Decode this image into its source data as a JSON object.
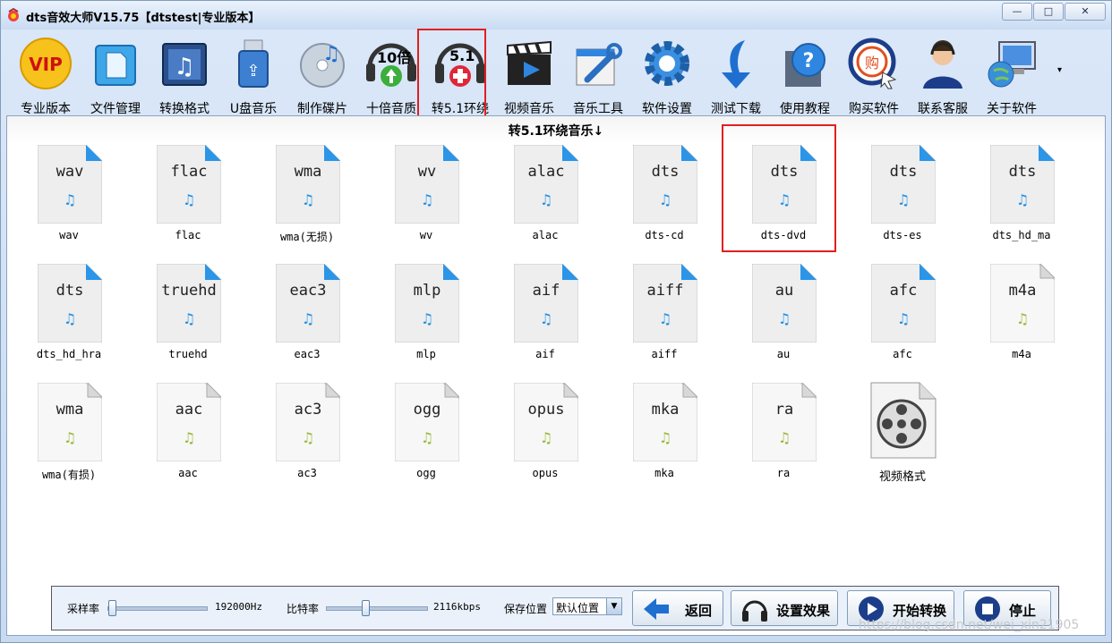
{
  "app": {
    "title": "dts音效大师V15.75【dtstest|专业版本】",
    "window_buttons": {
      "minimize": "—",
      "maximize": "□",
      "close": "✕"
    }
  },
  "toolbar": {
    "items": [
      {
        "label": "专业版本",
        "icon": "vip-badge-icon"
      },
      {
        "label": "文件管理",
        "icon": "folder-icon"
      },
      {
        "label": "转换格式",
        "icon": "music-convert-icon"
      },
      {
        "label": "U盘音乐",
        "icon": "usb-drive-icon"
      },
      {
        "label": "制作碟片",
        "icon": "disc-icon"
      },
      {
        "label": "十倍音质",
        "icon": "10x-quality-icon"
      },
      {
        "label": "转5.1环绕",
        "icon": "surround-5-1-icon"
      },
      {
        "label": "视频音乐",
        "icon": "clapperboard-icon"
      },
      {
        "label": "音乐工具",
        "icon": "tools-icon"
      },
      {
        "label": "软件设置",
        "icon": "gear-icon"
      },
      {
        "label": "测试下载",
        "icon": "download-arrow-icon"
      },
      {
        "label": "使用教程",
        "icon": "help-icon"
      },
      {
        "label": "购买软件",
        "icon": "buy-icon"
      },
      {
        "label": "联系客服",
        "icon": "support-agent-icon"
      },
      {
        "label": "关于软件",
        "icon": "computer-globe-icon"
      }
    ],
    "badge_10x": "10倍",
    "badge_51": "5.1",
    "more_arrow": "▾"
  },
  "panel": {
    "title": "转5.1环绕音乐↓"
  },
  "files": [
    {
      "ext": "wav",
      "label": "wav",
      "style": "blue"
    },
    {
      "ext": "flac",
      "label": "flac",
      "style": "blue"
    },
    {
      "ext": "wma",
      "label": "wma(无损)",
      "style": "blue"
    },
    {
      "ext": "wv",
      "label": "wv",
      "style": "blue"
    },
    {
      "ext": "alac",
      "label": "alac",
      "style": "blue"
    },
    {
      "ext": "dts",
      "label": "dts-cd",
      "style": "blue"
    },
    {
      "ext": "dts",
      "label": "dts-dvd",
      "style": "blue"
    },
    {
      "ext": "dts",
      "label": "dts-es",
      "style": "blue"
    },
    {
      "ext": "dts",
      "label": "dts_hd_ma",
      "style": "blue"
    },
    {
      "ext": "dts",
      "label": "dts_hd_hra",
      "style": "blue"
    },
    {
      "ext": "truehd",
      "label": "truehd",
      "style": "blue"
    },
    {
      "ext": "eac3",
      "label": "eac3",
      "style": "blue"
    },
    {
      "ext": "mlp",
      "label": "mlp",
      "style": "blue"
    },
    {
      "ext": "aif",
      "label": "aif",
      "style": "blue"
    },
    {
      "ext": "aiff",
      "label": "aiff",
      "style": "blue"
    },
    {
      "ext": "au",
      "label": "au",
      "style": "blue"
    },
    {
      "ext": "afc",
      "label": "afc",
      "style": "blue"
    },
    {
      "ext": "m4a",
      "label": "m4a",
      "style": "green"
    },
    {
      "ext": "wma",
      "label": "wma(有损)",
      "style": "green"
    },
    {
      "ext": "aac",
      "label": "aac",
      "style": "green"
    },
    {
      "ext": "ac3",
      "label": "ac3",
      "style": "green"
    },
    {
      "ext": "ogg",
      "label": "ogg",
      "style": "green"
    },
    {
      "ext": "opus",
      "label": "opus",
      "style": "green"
    },
    {
      "ext": "mka",
      "label": "mka",
      "style": "green"
    },
    {
      "ext": "ra",
      "label": "ra",
      "style": "green"
    },
    {
      "ext": "",
      "label": "视频格式",
      "style": "film"
    }
  ],
  "bottom": {
    "sample_rate_label": "采样率",
    "sample_rate_value": "192000Hz",
    "sample_rate_level": 0.0,
    "bitrate_label": "比特率",
    "bitrate_value": "2116kbps",
    "bitrate_level": 0.38,
    "save_location_label": "保存位置",
    "save_location_value": "默认位置",
    "buttons": {
      "back": "返回",
      "settings": "设置效果",
      "start": "开始转换",
      "stop": "停止"
    }
  },
  "watermark": "https://blog.csdn.net/wei_xin21905"
}
